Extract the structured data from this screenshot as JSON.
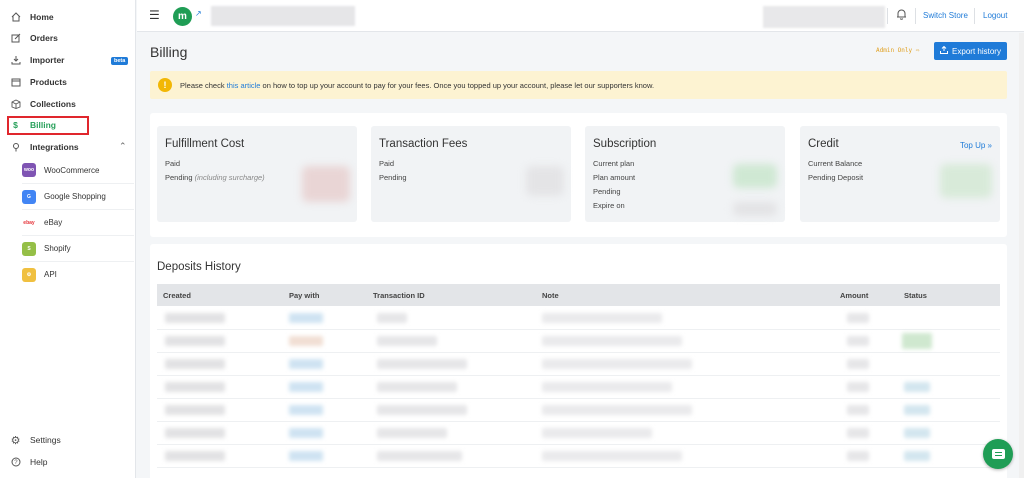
{
  "sidebar": {
    "items": [
      {
        "label": "Home",
        "icon": "home-icon"
      },
      {
        "label": "Orders",
        "icon": "edit-icon"
      },
      {
        "label": "Importer",
        "icon": "download-icon",
        "badge": "beta"
      },
      {
        "label": "Products",
        "icon": "box-icon"
      },
      {
        "label": "Collections",
        "icon": "collection-icon"
      },
      {
        "label": "Billing",
        "icon": "dollar-icon"
      },
      {
        "label": "Integrations",
        "icon": "plug-icon"
      }
    ],
    "integrations": [
      {
        "label": "WooCommerce",
        "logo": "woo"
      },
      {
        "label": "Google Shopping",
        "logo": "gshop"
      },
      {
        "label": "eBay",
        "logo": "ebay"
      },
      {
        "label": "Shopify",
        "logo": "shopify"
      },
      {
        "label": "API",
        "logo": "api"
      }
    ],
    "bottom": [
      {
        "label": "Settings",
        "icon": "gear-icon"
      },
      {
        "label": "Help",
        "icon": "help-icon"
      }
    ]
  },
  "topbar": {
    "switch_store": "Switch Store",
    "logout": "Logout"
  },
  "page": {
    "title": "Billing",
    "admin_only": "Admin Only",
    "export_label": "Export history"
  },
  "alert": {
    "prefix": "Please check ",
    "link": "this article",
    "suffix": " on how to top up your account to pay for your fees. Once you topped up your account, please let our supporters know."
  },
  "cards": {
    "fulfillment": {
      "title": "Fulfillment Cost",
      "paid": "Paid",
      "pending": "Pending",
      "pending_note": "(including surcharge)"
    },
    "transaction": {
      "title": "Transaction Fees",
      "paid": "Paid",
      "pending": "Pending"
    },
    "subscription": {
      "title": "Subscription",
      "current_plan": "Current plan",
      "plan_amount": "Plan amount",
      "pending": "Pending",
      "expire_on": "Expire on"
    },
    "credit": {
      "title": "Credit",
      "top_up": "Top Up",
      "current_balance": "Current Balance",
      "pending_deposit": "Pending Deposit"
    }
  },
  "deposits": {
    "title": "Deposits History",
    "columns": [
      "Created",
      "Pay with",
      "Transaction ID",
      "Note",
      "Amount",
      "Status"
    ]
  },
  "colors": {
    "accent": "#1f7bd8",
    "brand": "#1f9d55",
    "alert_bg": "#fdf3d2",
    "active_outline": "#e0262d"
  }
}
